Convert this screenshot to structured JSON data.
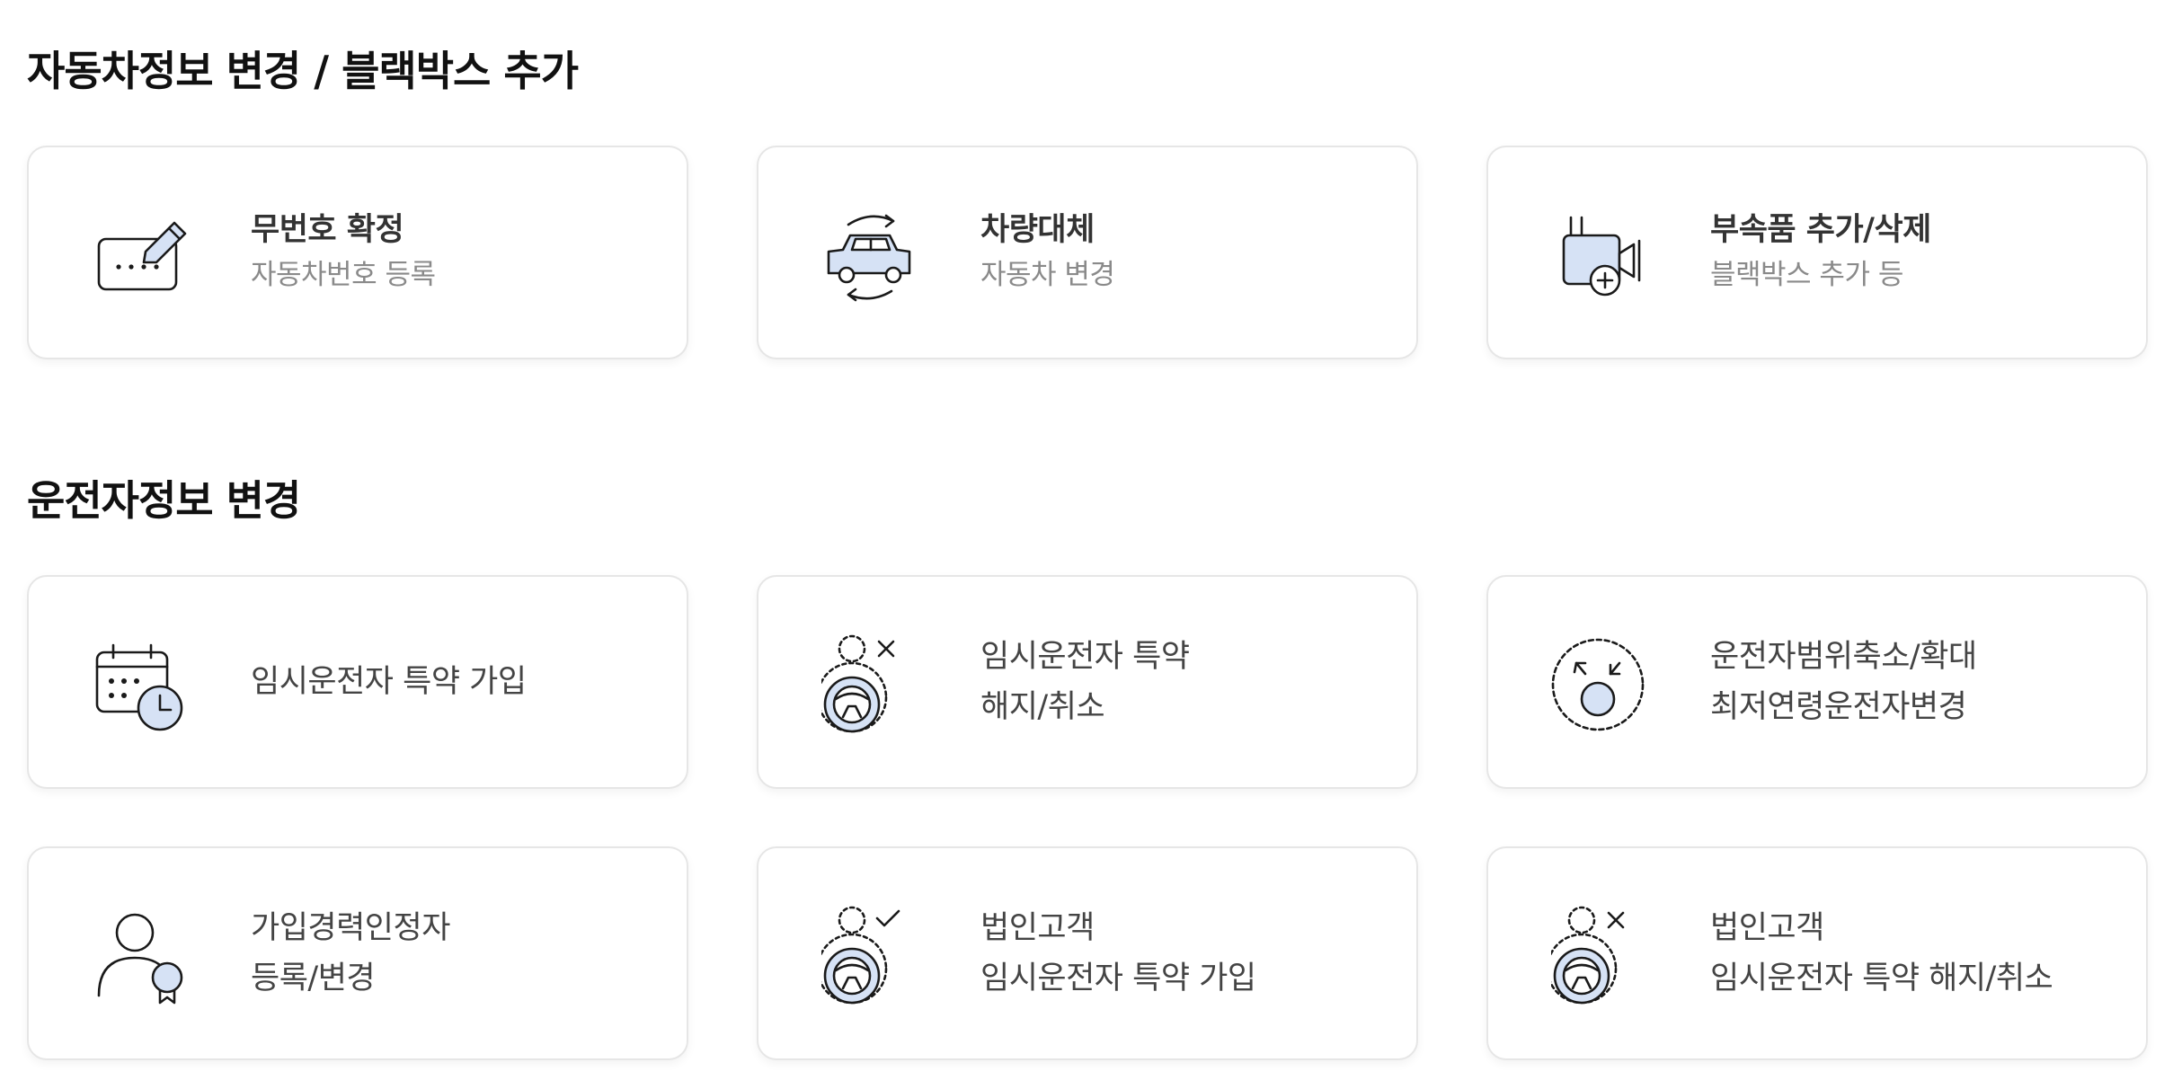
{
  "sections": {
    "car_title": "자동차정보 변경 / 블랙박스 추가",
    "driver_title": "운전자정보 변경"
  },
  "colors": {
    "icon_fill": "#d6e2f5",
    "icon_stroke": "#1a1a1a",
    "card_border": "#e6e6e6",
    "title_text": "#111111",
    "sub_text": "#8a8a8a"
  },
  "cards": {
    "plate": {
      "title": "무번호 확정",
      "subtitle": "자동차번호 등록",
      "icon": "license-plate-edit-icon"
    },
    "replace": {
      "title": "차량대체",
      "subtitle": "자동차 변경",
      "icon": "car-swap-icon"
    },
    "accessory": {
      "title": "부속품 추가/삭제",
      "subtitle": "블랙박스 추가 등",
      "icon": "dashcam-add-icon"
    },
    "temp_join": {
      "line1": "임시운전자 특약 가입",
      "icon": "calendar-clock-icon"
    },
    "temp_cancel": {
      "line1": "임시운전자 특약",
      "line2": "해지/취소",
      "icon": "driver-remove-icon"
    },
    "range": {
      "line1": "운전자범위축소/확대",
      "line2": "최저연령운전자변경",
      "icon": "driver-range-icon"
    },
    "experience": {
      "line1": "가입경력인정자",
      "line2": "등록/변경",
      "icon": "person-badge-icon"
    },
    "corp_join": {
      "line1": "법인고객",
      "line2": "임시운전자 특약 가입",
      "icon": "driver-check-icon"
    },
    "corp_cancel": {
      "line1": "법인고객",
      "line2": "임시운전자 특약 해지/취소",
      "icon": "driver-remove-icon"
    }
  }
}
